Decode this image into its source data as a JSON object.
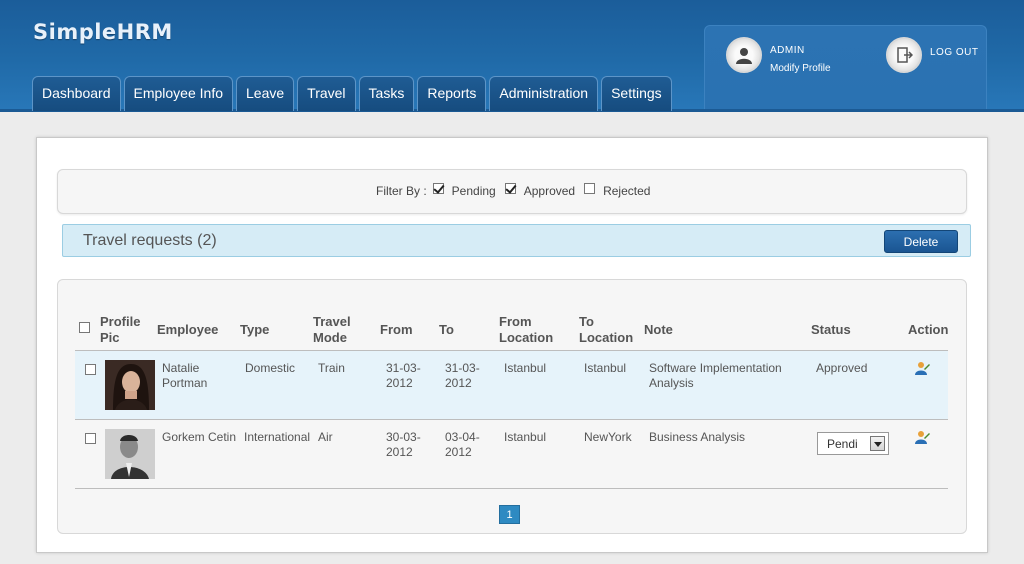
{
  "app": {
    "name": "SimpleHRM"
  },
  "nav": {
    "tabs": [
      {
        "label": "Dashboard"
      },
      {
        "label": "Employee Info"
      },
      {
        "label": "Leave"
      },
      {
        "label": "Travel"
      },
      {
        "label": "Tasks"
      },
      {
        "label": "Reports"
      },
      {
        "label": "Administration"
      },
      {
        "label": "Settings"
      }
    ]
  },
  "user": {
    "name": "ADMIN",
    "modify_label": "Modify Profile",
    "logout_label": "LOG OUT"
  },
  "filter": {
    "label": "Filter By :",
    "options": [
      {
        "label": "Pending",
        "checked": true
      },
      {
        "label": "Approved",
        "checked": true
      },
      {
        "label": "Rejected",
        "checked": false
      }
    ]
  },
  "section": {
    "title": "Travel requests (2)",
    "delete_label": "Delete"
  },
  "table": {
    "headers": {
      "profile_pic": "Profile Pic",
      "employee": "Employee",
      "type": "Type",
      "travel_mode": "Travel Mode",
      "from": "From",
      "to": "To",
      "from_location": "From Location",
      "to_location": "To Location",
      "note": "Note",
      "status": "Status",
      "action": "Action"
    },
    "rows": [
      {
        "employee": "Natalie Portman",
        "type": "Domestic",
        "travel_mode": "Train",
        "from": "31-03-2012",
        "to": "31-03-2012",
        "from_location": "Istanbul",
        "to_location": "Istanbul",
        "note": "Software Implementation Analysis",
        "status": "Approved"
      },
      {
        "employee": "Gorkem Cetin",
        "type": "International",
        "travel_mode": "Air",
        "from": "30-03-2012",
        "to": "03-04-2012",
        "from_location": "Istanbul",
        "to_location": "NewYork",
        "note": "Business Analysis",
        "status": "Pendi"
      }
    ]
  },
  "pagination": {
    "current": "1"
  },
  "colors": {
    "header": "#206aa8",
    "accent": "#2e8ac2",
    "row_highlight": "#e6f3fa"
  }
}
